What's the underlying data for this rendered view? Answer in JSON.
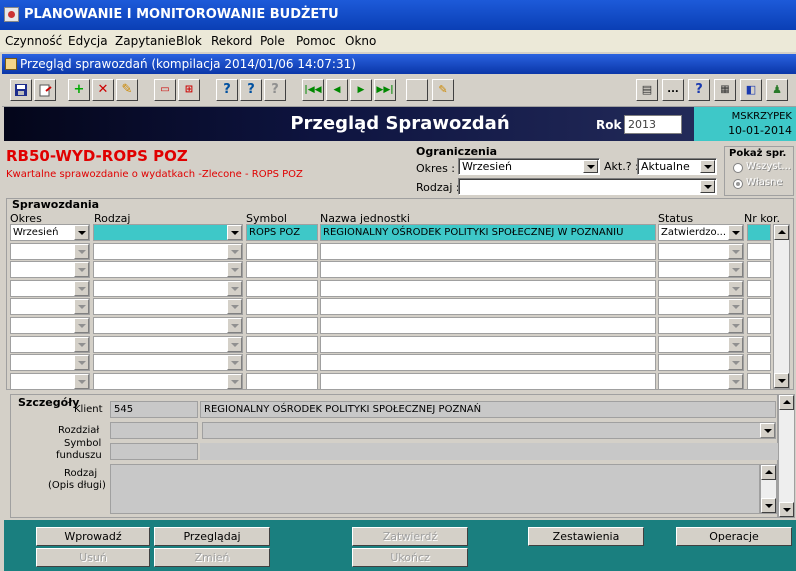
{
  "app": {
    "title": "PLANOWANIE I MONITOROWANIE BUDŻETU"
  },
  "menu": [
    "Czynność",
    "Edycja",
    "Zapytanie",
    "Blok",
    "Rekord",
    "Pole",
    "Pomoc",
    "Okno"
  ],
  "window": {
    "title": "Przegląd sprawozdań (kompilacja 2014/01/06 14:07:31)"
  },
  "toolbar": {
    "icons": [
      "save-icon",
      "exit-icon",
      "add-icon",
      "delete-icon",
      "clear-icon",
      "insert-record-icon",
      "duplicate-icon",
      "query-icon",
      "execute-query-icon",
      "count-query-icon",
      "first-record-icon",
      "previous-record-icon",
      "next-record-icon",
      "last-record-icon",
      "blank-icon",
      "edit-icon"
    ],
    "right_icons": [
      "print-icon",
      "ellipsis-icon",
      "help-icon",
      "calculator-icon",
      "info-icon",
      "user-icon"
    ],
    "ellipsis": "...",
    "help": "?"
  },
  "header": {
    "title": "Przegląd Sprawozdań",
    "rok_label": "Rok",
    "rok_value": "2013",
    "user": "MSKRZYPEK",
    "date": "10-01-2014"
  },
  "report": {
    "code": "RB50-WYD-ROPS POZ",
    "description": "Kwartalne sprawozdanie o wydatkach -Zlecone  - ROPS POZ"
  },
  "filters": {
    "title": "Ograniczenia",
    "okres_label": "Okres :",
    "okres_value": "Wrzesień",
    "akt_label": "Akt.? :",
    "akt_value": "Aktualne",
    "rodzaj_label": "Rodzaj :",
    "rodzaj_value": ""
  },
  "show": {
    "title": "Pokaż spr.",
    "all_label": "Wszyst...",
    "own_label": "Własne"
  },
  "grid": {
    "title": "Sprawozdania",
    "headers": {
      "okres": "Okres",
      "rodzaj": "Rodzaj",
      "symbol": "Symbol",
      "nazwa": "Nazwa jednostki",
      "status": "Status",
      "nr_kor": "Nr kor."
    },
    "rows": [
      {
        "okres": "Wrzesień",
        "rodzaj": "",
        "symbol": "ROPS POZ",
        "nazwa": "REGIONALNY OŚRODEK POLITYKI SPOŁECZNEJ W POZNANIU",
        "status": "Zatwierdzo...",
        "nr_kor": ""
      },
      {
        "okres": "",
        "rodzaj": "",
        "symbol": "",
        "nazwa": "",
        "status": "",
        "nr_kor": ""
      },
      {
        "okres": "",
        "rodzaj": "",
        "symbol": "",
        "nazwa": "",
        "status": "",
        "nr_kor": ""
      },
      {
        "okres": "",
        "rodzaj": "",
        "symbol": "",
        "nazwa": "",
        "status": "",
        "nr_kor": ""
      },
      {
        "okres": "",
        "rodzaj": "",
        "symbol": "",
        "nazwa": "",
        "status": "",
        "nr_kor": ""
      },
      {
        "okres": "",
        "rodzaj": "",
        "symbol": "",
        "nazwa": "",
        "status": "",
        "nr_kor": ""
      },
      {
        "okres": "",
        "rodzaj": "",
        "symbol": "",
        "nazwa": "",
        "status": "",
        "nr_kor": ""
      },
      {
        "okres": "",
        "rodzaj": "",
        "symbol": "",
        "nazwa": "",
        "status": "",
        "nr_kor": ""
      },
      {
        "okres": "",
        "rodzaj": "",
        "symbol": "",
        "nazwa": "",
        "status": "",
        "nr_kor": ""
      }
    ]
  },
  "details": {
    "title": "Szczegóły",
    "klient_label": "Klient",
    "klient_id": "545",
    "klient_name": "REGIONALNY OŚRODEK POLITYKI SPOŁECZNEJ POZNAŃ",
    "rozdzial_label": "Rozdział",
    "symbol_label_1": "Symbol",
    "symbol_label_2": "funduszu",
    "rodzaj_label_1": "Rodzaj",
    "rodzaj_label_2": "(Opis długi)"
  },
  "buttons": {
    "wprowadz": "Wprowadź",
    "przegladaj": "Przeglądaj",
    "zatwierdz": "Zatwierdź",
    "zestawienia": "Zestawienia",
    "operacje": "Operacje",
    "usun": "Usuń",
    "zmien": "Zmień",
    "ukoncz": "Ukończ"
  },
  "colors": {
    "title_bar": "#0a3fb5",
    "header": "#0e1440",
    "accent": "#3ec8c8",
    "bottom": "#1a7f7f",
    "report_red": "#e00000"
  }
}
